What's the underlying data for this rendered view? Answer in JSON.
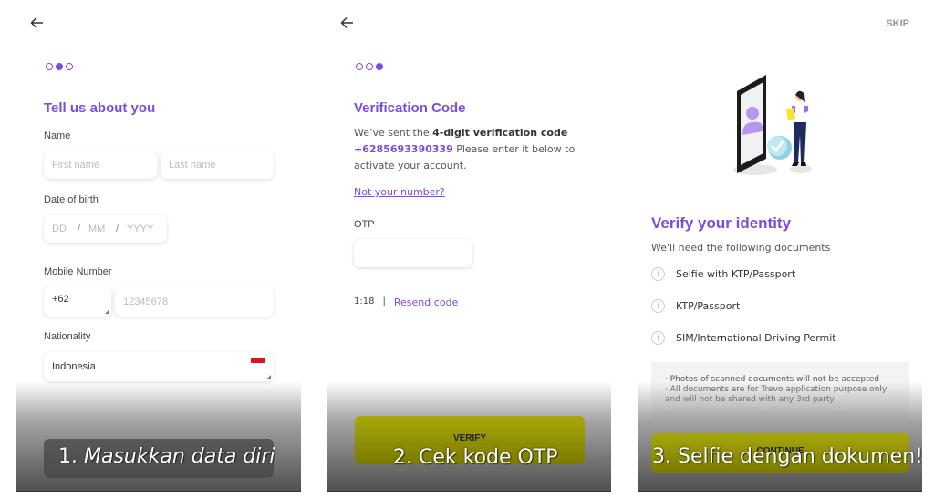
{
  "brand": {
    "accent": "#7b4ce0",
    "button": "#9a9a06",
    "flag_red": "#e0121b"
  },
  "screen1": {
    "back_icon": "arrow-left-icon",
    "progress": {
      "total": 3,
      "current": 2
    },
    "title": "Tell us about you",
    "name_label": "Name",
    "first_name_placeholder": "First name",
    "last_name_placeholder": "Last name",
    "dob_label": "Date of birth",
    "dob_dd": "DD",
    "dob_mm": "MM",
    "dob_yyyy": "YYYY",
    "dob_sep": "/",
    "mobile_label": "Mobile Number",
    "country_code": "+62",
    "mobile_placeholder": "12345678",
    "nationality_label": "Nationality",
    "nationality_value": "Indonesia",
    "flag_icon": "indonesia-flag-icon",
    "caption_num": "1.",
    "caption_text": "Masukkan data diri"
  },
  "screen2": {
    "back_icon": "arrow-left-icon",
    "progress": {
      "total": 3,
      "current": 3
    },
    "title": "Verification Code",
    "desc_prefix": "We’ve sent the ",
    "desc_bold": "4-digit verification code",
    "phone": "+6285693390339",
    "desc_suffix": " Please enter it below to activate your account.",
    "not_your_number": "Not your number?",
    "otp_label": "OTP",
    "otp_value": "",
    "timer": "1:18",
    "separator": "|",
    "resend": "Resend code",
    "verify_button": "VERIFY",
    "caption": "2. Cek kode OTP"
  },
  "screen3": {
    "skip": "SKIP",
    "illustration": "phone-identity-verification-illustration",
    "title": "Verify your identity",
    "subtitle": "We'll need the following documents",
    "documents": [
      {
        "label": "Selfie with KTP/Passport",
        "icon": "info-icon"
      },
      {
        "label": "KTP/Passport",
        "icon": "info-icon"
      },
      {
        "label": "SIM/International Driving Permit",
        "icon": "info-icon"
      }
    ],
    "notes": [
      "· Photos of scanned documents will not be accepted",
      "· All documents are for Trevo application purpose only and will not be shared with any 3rd party"
    ],
    "continue_button": "CONTINUE",
    "caption": "3. Selfie dengan dokumen!"
  }
}
